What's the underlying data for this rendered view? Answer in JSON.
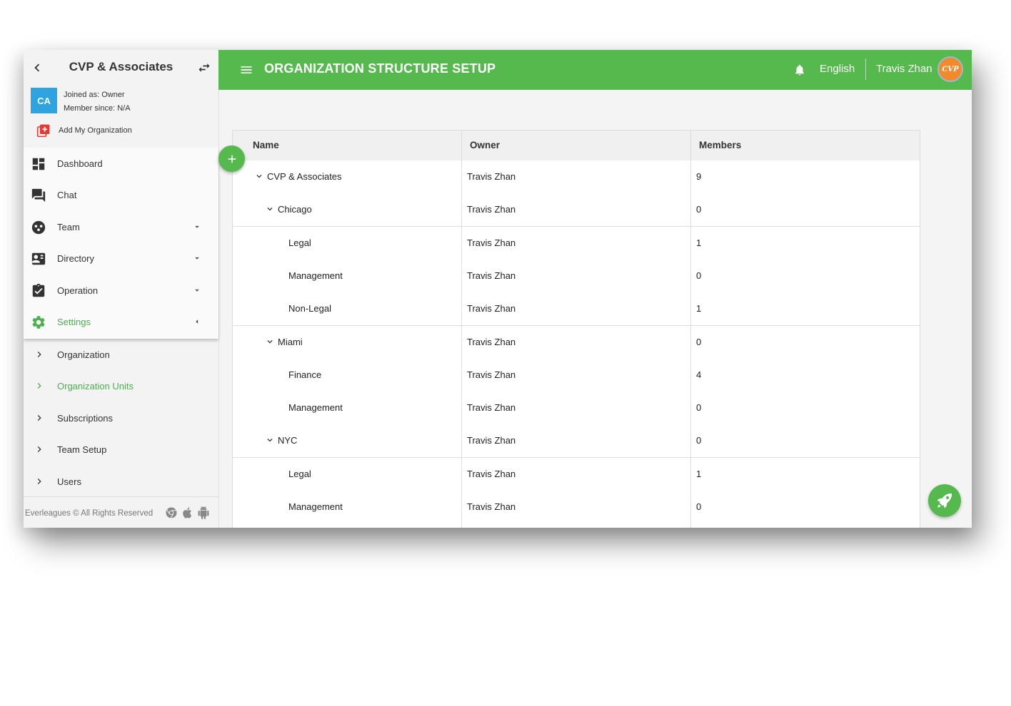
{
  "sidebar": {
    "org_name": "CVP & Associates",
    "avatar_initials": "CA",
    "joined_as": "Joined as: Owner",
    "member_since": "Member since: N/A",
    "add_org_label": "Add My Organization",
    "menu": [
      {
        "label": "Dashboard",
        "icon": "dashboard-icon"
      },
      {
        "label": "Chat",
        "icon": "chat-icon"
      },
      {
        "label": "Team",
        "icon": "team-icon"
      },
      {
        "label": "Directory",
        "icon": "directory-icon"
      },
      {
        "label": "Operation",
        "icon": "operation-icon"
      },
      {
        "label": "Settings",
        "icon": "settings-icon"
      }
    ],
    "submenu": [
      {
        "label": "Organization"
      },
      {
        "label": "Organization Units"
      },
      {
        "label": "Subscriptions"
      },
      {
        "label": "Team Setup"
      },
      {
        "label": "Users"
      }
    ],
    "footer": "Everleagues © All Rights Reserved",
    "platforms": [
      "chrome-icon",
      "apple-icon",
      "android-icon"
    ]
  },
  "header": {
    "title": "ORGANIZATION STRUCTURE SETUP",
    "language": "English",
    "user_name": "Travis Zhan",
    "avatar_text": "CVP"
  },
  "table": {
    "columns": [
      "Name",
      "Owner",
      "Members"
    ],
    "rows": [
      {
        "name": "CVP & Associates",
        "owner": "Travis Zhan",
        "members": "9"
      },
      {
        "name": "Chicago",
        "owner": "Travis Zhan",
        "members": "0"
      },
      {
        "name": "Legal",
        "owner": "Travis Zhan",
        "members": "1"
      },
      {
        "name": "Management",
        "owner": "Travis Zhan",
        "members": "0"
      },
      {
        "name": "Non-Legal",
        "owner": "Travis Zhan",
        "members": "1"
      },
      {
        "name": "Miami",
        "owner": "Travis Zhan",
        "members": "0"
      },
      {
        "name": "Finance",
        "owner": "Travis Zhan",
        "members": "4"
      },
      {
        "name": "Management",
        "owner": "Travis Zhan",
        "members": "0"
      },
      {
        "name": "NYC",
        "owner": "Travis Zhan",
        "members": "0"
      },
      {
        "name": "Legal",
        "owner": "Travis Zhan",
        "members": "1"
      },
      {
        "name": "Management",
        "owner": "Travis Zhan",
        "members": "0"
      }
    ]
  },
  "colors": {
    "accent": "#55b94e",
    "avatar_blue": "#2ea3e0",
    "add_org_red": "#e53935"
  }
}
